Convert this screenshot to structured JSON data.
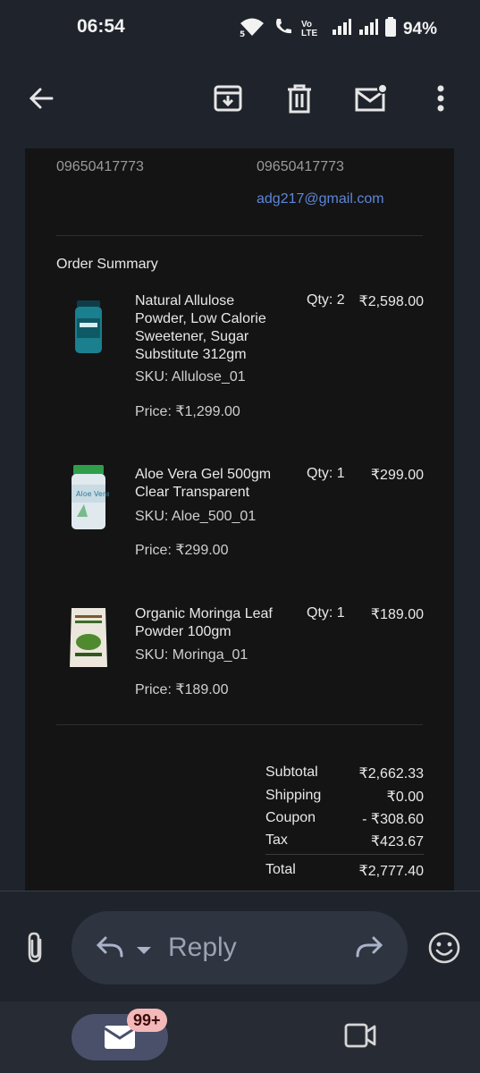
{
  "status_bar": {
    "time": "06:54",
    "network_5g": "5",
    "volte": "Vo LTE",
    "battery": "94%"
  },
  "app_bar": {
    "icons": [
      "back-arrow-icon",
      "archive-icon",
      "delete-icon",
      "mark-unread-icon",
      "more-vert-icon"
    ]
  },
  "email": {
    "contact_left_phone": "09650417773",
    "contact_right_phone": "09650417773",
    "contact_right_email": "adg217@gmail.com",
    "order_summary_title": "Order Summary",
    "items": [
      {
        "name": "Natural Allulose Powder, Low Calorie Sweetener, Sugar Substitute 312gm",
        "sku": "SKU: Allulose_01",
        "price": "Price: ₹1,299.00",
        "qty": "Qty: 2",
        "amount": "₹2,598.00"
      },
      {
        "name": "Aloe Vera Gel 500gm Clear Transparent",
        "sku": "SKU: Aloe_500_01",
        "price": "Price: ₹299.00",
        "qty": "Qty: 1",
        "amount": "₹299.00"
      },
      {
        "name": "Organic Moringa Leaf Powder 100gm",
        "sku": "SKU: Moringa_01",
        "price": "Price: ₹189.00",
        "qty": "Qty: 1",
        "amount": "₹189.00"
      }
    ],
    "totals": {
      "subtotal_label": "Subtotal",
      "subtotal_value": "₹2,662.33",
      "shipping_label": "Shipping",
      "shipping_value": "₹0.00",
      "coupon_label": "Coupon",
      "coupon_value": "- ₹308.60",
      "tax_label": "Tax",
      "tax_value": "₹423.67",
      "total_label": "Total",
      "total_value": "₹2,777.40"
    }
  },
  "reply_bar": {
    "reply_label": "Reply"
  },
  "bottom_nav": {
    "mail_badge": "99+"
  },
  "colors": {
    "background": "#1f232b",
    "card": "#141414",
    "link": "#5d86d8",
    "badge": "#f4b8b8"
  }
}
